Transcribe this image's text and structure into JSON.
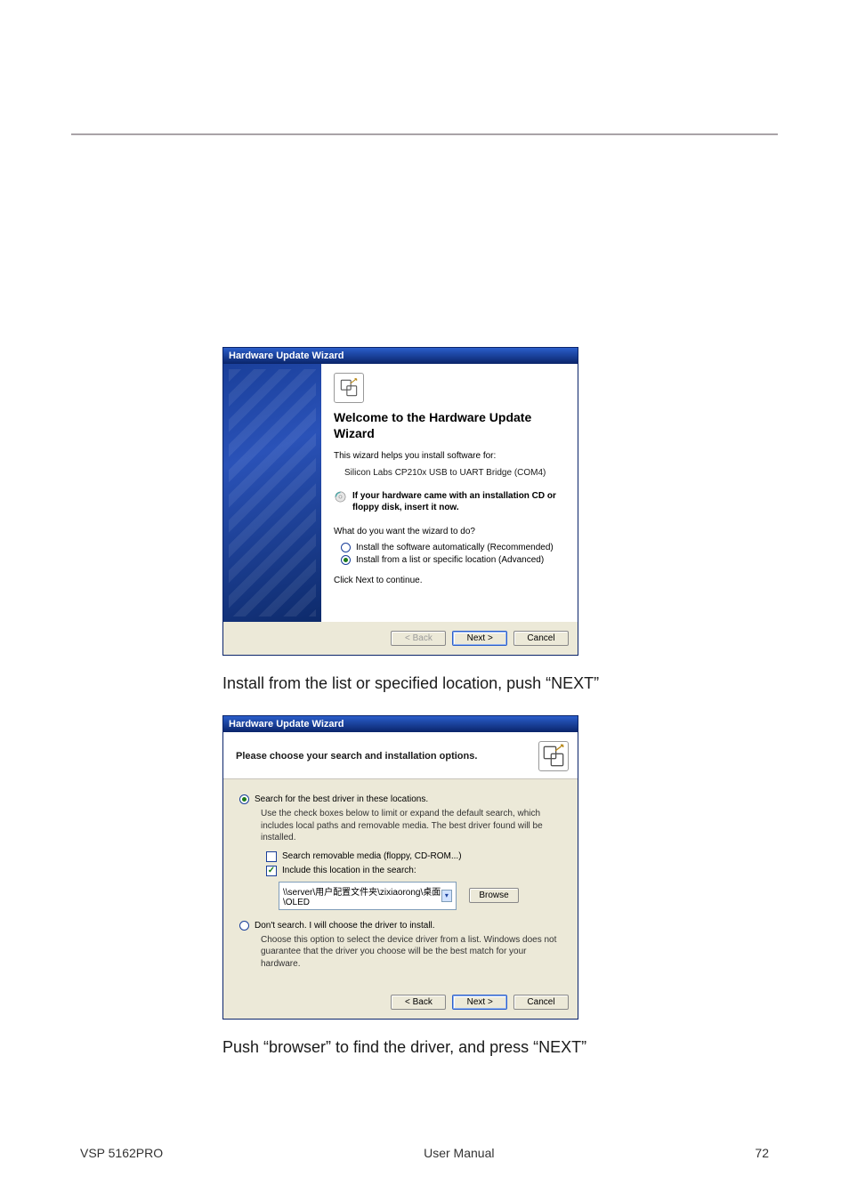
{
  "page": {
    "caption1": "Install from the list or specified location, push “NEXT”",
    "caption2": "Push “browser” to find the driver, and press “NEXT”",
    "footer_left": "VSP 5162PRO",
    "footer_center": "User Manual",
    "footer_page": "72"
  },
  "wizard_shared": {
    "title": "Hardware Update Wizard",
    "back_label": "< Back",
    "next_label": "Next >",
    "cancel_label": "Cancel"
  },
  "wizard1": {
    "heading": "Welcome to the Hardware Update Wizard",
    "intro": "This wizard helps you install software for:",
    "device": "Silicon Labs CP210x USB to UART Bridge (COM4)",
    "cd_hint": "If your hardware came with an installation CD or floppy disk, insert it now.",
    "question": "What do you want the wizard to do?",
    "opt_auto": "Install the software automatically (Recommended)",
    "opt_list": "Install from a list or specific location (Advanced)",
    "continue": "Click Next to continue."
  },
  "wizard2": {
    "header": "Please choose your search and installation options.",
    "opt_search": "Search for the best driver in these locations.",
    "search_desc": "Use the check boxes below to limit or expand the default search, which includes local paths and removable media. The best driver found will be installed.",
    "chk_removable": "Search removable media (floppy, CD-ROM...)",
    "chk_include": "Include this location in the search:",
    "path_value": "\\\\server\\用户配置文件夹\\zixiaorong\\桌面\\OLED",
    "browse_label": "Browse",
    "opt_dont": "Don't search. I will choose the driver to install.",
    "dont_desc": "Choose this option to select the device driver from a list. Windows does not guarantee that the driver you choose will be the best match for your hardware."
  }
}
